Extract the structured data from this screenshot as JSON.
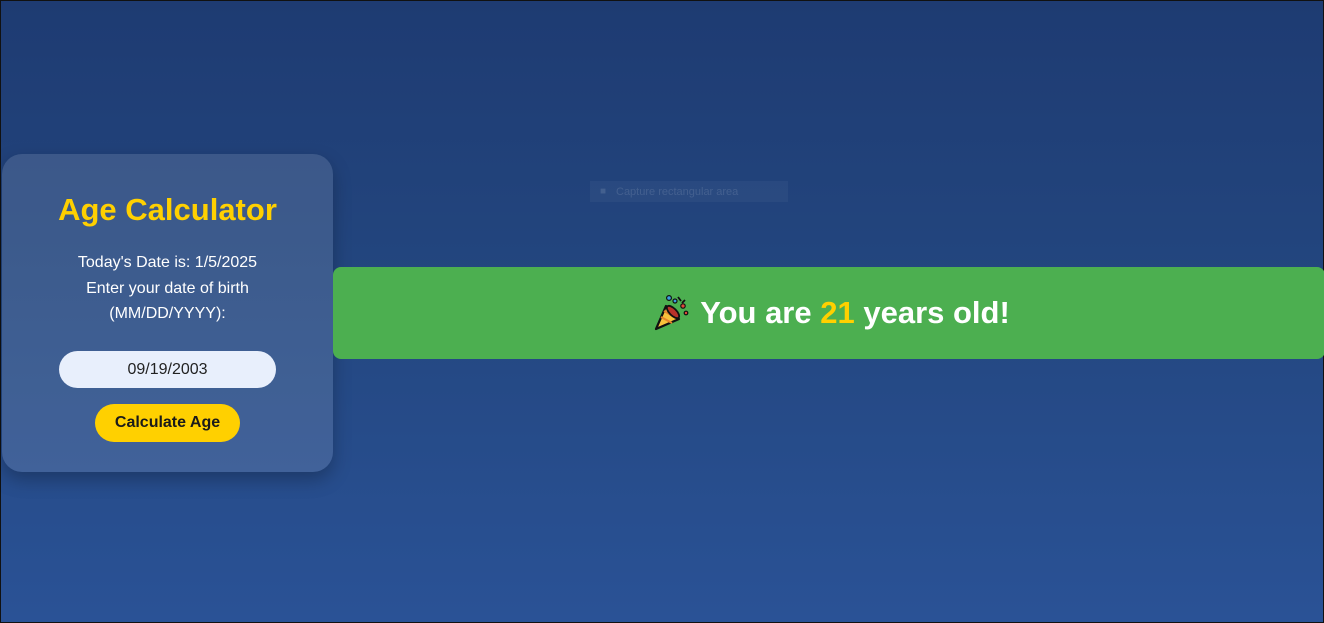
{
  "calculator": {
    "title": "Age Calculator",
    "today_text": "Today's Date is: 1/5/2025",
    "prompt_text": "Enter your date of birth (MM/DD/YYYY):",
    "dob_value": "09/19/2003",
    "button_label": "Calculate Age"
  },
  "result": {
    "icon": "party-popper-icon",
    "prefix": "You are",
    "age": "21",
    "suffix": "years old!"
  },
  "overlay": {
    "label": "Capture rectangular area"
  },
  "colors": {
    "accent": "#ffd000",
    "success": "#4caf50",
    "background_top": "#1e3b72",
    "background_bottom": "#2a5296"
  }
}
